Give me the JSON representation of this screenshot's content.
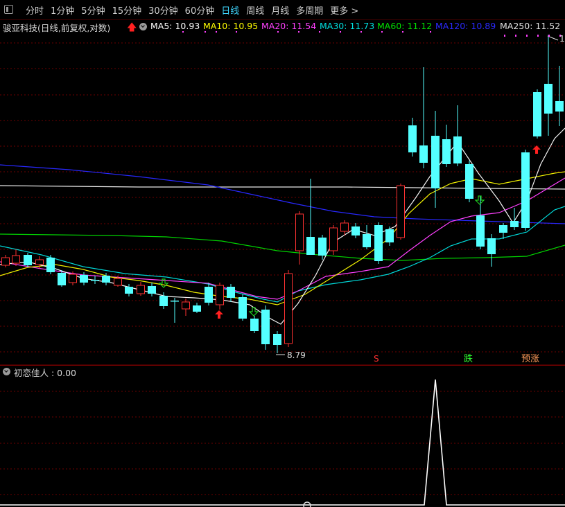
{
  "toolbar": {
    "tabs": [
      {
        "label": "分时"
      },
      {
        "label": "1分钟"
      },
      {
        "label": "5分钟"
      },
      {
        "label": "15分钟"
      },
      {
        "label": "30分钟"
      },
      {
        "label": "60分钟"
      },
      {
        "label": "日线"
      },
      {
        "label": "周线"
      },
      {
        "label": "月线"
      },
      {
        "label": "多周期"
      },
      {
        "label": "更多 >"
      }
    ],
    "active_tab": "日线"
  },
  "chart": {
    "title": "骏亚科技(日线,前复权,对数)",
    "ma": [
      {
        "label": "MA5: 10.93",
        "color": "#ffffff"
      },
      {
        "label": "MA10: 10.95",
        "color": "#ffff00"
      },
      {
        "label": "MA20: 11.54",
        "color": "#ff40ff"
      },
      {
        "label": "MA30: 11.73",
        "color": "#00e0e0"
      },
      {
        "label": "MA60: 11.12",
        "color": "#00e000"
      },
      {
        "label": "MA120: 10.89",
        "color": "#2a2aff"
      },
      {
        "label": "MA250: 11.52",
        "color": "#e0e0e0"
      }
    ],
    "low_label": "8.79",
    "high_label": "1",
    "signals": {
      "s": "S",
      "die": "跌",
      "yuzhang": "预涨"
    }
  },
  "indicator": {
    "label": "初恋佳人 : 0.00"
  },
  "colors": {
    "up": "#ff3232",
    "down": "#54ffff",
    "grid": "#6e0000",
    "arrow_up": "#ff2020",
    "arrow_down": "#20d020"
  }
}
